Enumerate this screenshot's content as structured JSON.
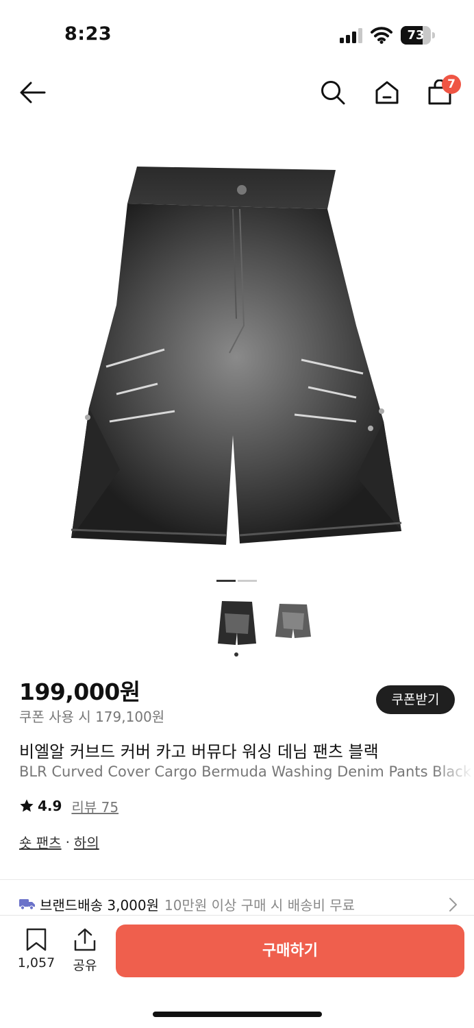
{
  "status_bar": {
    "time": "8:23",
    "battery_pct": "73",
    "battery_level": 0.73
  },
  "nav": {
    "cart_count": "7",
    "icons": [
      "back-arrow-icon",
      "search-icon",
      "home-icon",
      "shopping-bag-icon"
    ]
  },
  "gallery": {
    "page_count": 2,
    "current_page": 1,
    "thumbnails": 2,
    "selected_thumbnail": 1
  },
  "product": {
    "price": "199,000원",
    "coupon_price": "쿠폰 사용 시 179,100원",
    "coupon_button": "쿠폰받기",
    "title_ko": "비엘알 커브드 커버 카고 버뮤다 워싱 데님 팬츠 블랙",
    "title_en": "BLR Curved Cover Cargo Bermuda Washing Denim Pants Black",
    "rating": "4.9",
    "review_link": "리뷰 75",
    "category_1": "숏 팬츠",
    "category_sep": "·",
    "category_2": "하의"
  },
  "shipping": {
    "label": "브랜드배송 3,000원",
    "note": "10만원 이상 구매 시 배송비 무료"
  },
  "bottom_bar": {
    "bookmark_count": "1,057",
    "share_label": "공유",
    "buy_label": "구매하기"
  },
  "colors": {
    "accent": "#ef5f4d",
    "badge": "#ef5544",
    "dark_button": "#1f1f1f"
  }
}
